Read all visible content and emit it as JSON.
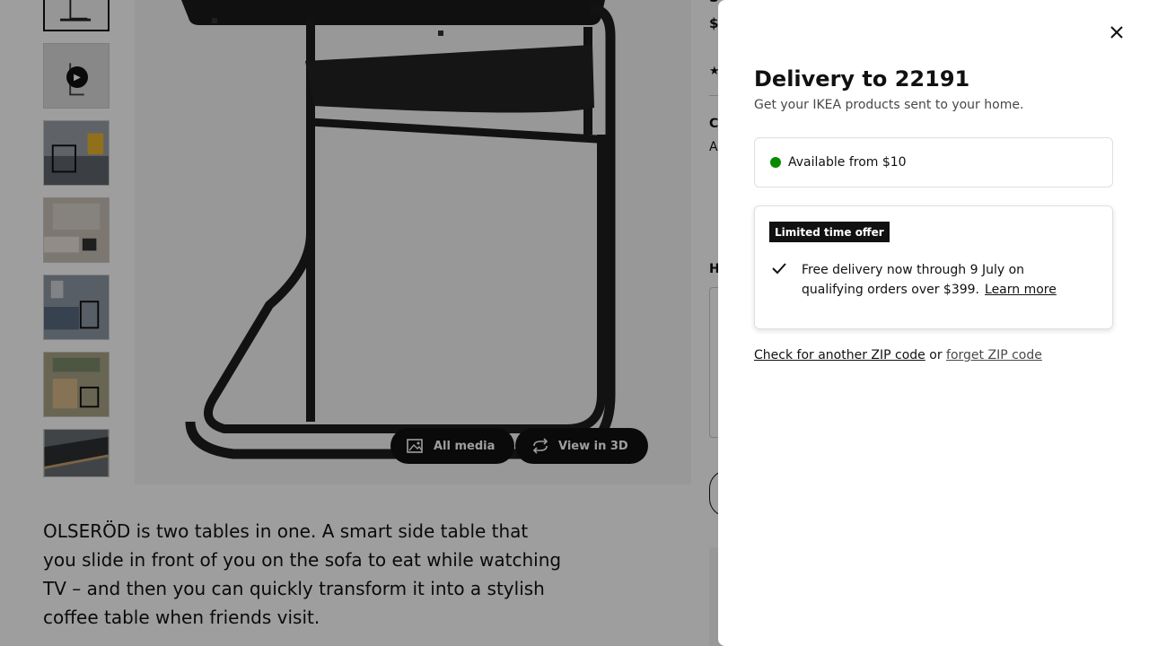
{
  "page": {
    "thumbnails": [
      {
        "alt": "product-thumb",
        "selected": true,
        "color": "#e9e9e9"
      },
      {
        "alt": "video-thumb",
        "selected": false,
        "color": "#d8d8d8"
      },
      {
        "alt": "living-room-thumb",
        "selected": false,
        "color": "#8a8f96"
      },
      {
        "alt": "lounge-thumb",
        "selected": false,
        "color": "#b9b3a7"
      },
      {
        "alt": "sofa-scene-thumb",
        "selected": false,
        "color": "#7f8a97"
      },
      {
        "alt": "armchair-scene-thumb",
        "selected": false,
        "color": "#9a9478"
      },
      {
        "alt": "tabletop-thumb",
        "selected": false,
        "color": "#5a5e62"
      }
    ],
    "all_media_label": "All media",
    "view_3d_label": "View in 3D",
    "description": "OLSERÖD is two tables in one. A smart side table that you slide in front of you on the sofa to eat while watching TV – and then you can quickly transform it into a stylish coffee table when friends visit.",
    "right_fragments": {
      "frag1": "S",
      "frag2": "$",
      "frag3": "C",
      "frag4": "A",
      "frag5": "H"
    }
  },
  "modal": {
    "close_label": "close",
    "title": "Delivery to 22191",
    "subtitle": "Get your IKEA products sent to your home.",
    "availability": "Available from $10",
    "availability_color": "#0a8a00",
    "offer_badge": "Limited time offer",
    "offer_text": "Free delivery now through 9 July on qualifying orders over $399.",
    "learn_more": "Learn more",
    "zip_check": "Check for another ZIP code",
    "zip_or": "or",
    "zip_forget": "forget ZIP code"
  }
}
